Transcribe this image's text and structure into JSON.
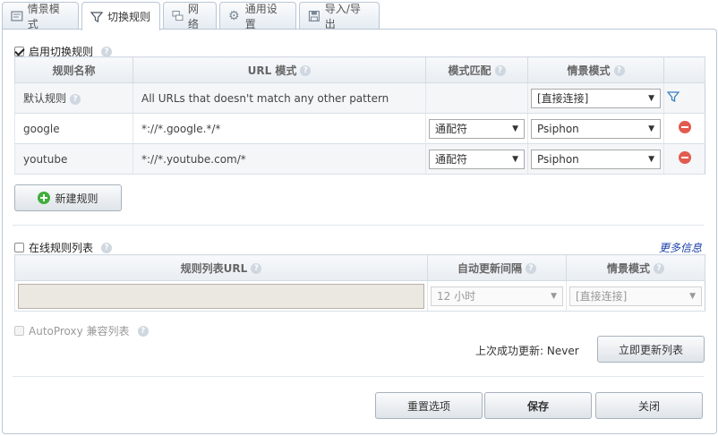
{
  "tabs": [
    {
      "label": "情景模式",
      "icon": "scene-icon"
    },
    {
      "label": "切换规则",
      "icon": "filter-icon"
    },
    {
      "label": "网络",
      "icon": "network-icon"
    },
    {
      "label": "通用设置",
      "icon": "gear-icon"
    },
    {
      "label": "导入/导出",
      "icon": "disk-icon"
    }
  ],
  "switch_rules": {
    "enable_label": "启用切换规则",
    "enabled": true,
    "columns": [
      "规则名称",
      "URL 模式",
      "模式匹配",
      "情景模式"
    ],
    "default_rule": {
      "name": "默认规则",
      "pattern": "All URLs that doesn't match any other pattern",
      "profile": "[直接连接]"
    },
    "rules": [
      {
        "name": "google",
        "pattern": "*://*.google.*/*",
        "match": "通配符",
        "profile": "Psiphon"
      },
      {
        "name": "youtube",
        "pattern": "*://*.youtube.com/*",
        "match": "通配符",
        "profile": "Psiphon"
      }
    ],
    "new_rule_label": "新建规则"
  },
  "online_list": {
    "enable_label": "在线规则列表",
    "enabled": false,
    "more_info": "更多信息",
    "columns": [
      "规则列表URL",
      "自动更新间隔",
      "情景模式"
    ],
    "url_value": "",
    "interval": "12 小时",
    "profile": "[直接连接]",
    "autoproxy_label": "AutoProxy 兼容列表",
    "last_update": "上次成功更新: Never",
    "update_now": "立即更新列表"
  },
  "footer": {
    "reset": "重置选项",
    "save": "保存",
    "close": "关闭"
  }
}
